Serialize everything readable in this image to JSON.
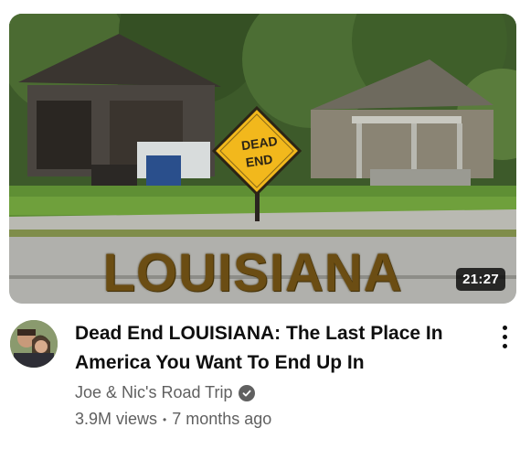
{
  "video": {
    "thumbnail_text": "LOUISIANA",
    "sign_text_line1": "DEAD",
    "sign_text_line2": "END",
    "duration": "21:27",
    "title": "Dead End LOUISIANA: The Last Place In America You Want To End Up In",
    "channel": "Joe & Nic's Road Trip",
    "views": "3.9M views",
    "separator": "•",
    "age": "7 months ago"
  },
  "icons": {
    "verified": "verified-check-icon",
    "more": "more-vert-icon"
  },
  "colors": {
    "title_text": "#0f0f0f",
    "secondary_text": "#606060",
    "thumbnail_title": "#6b4d13",
    "sign_yellow": "#f2b81c"
  }
}
